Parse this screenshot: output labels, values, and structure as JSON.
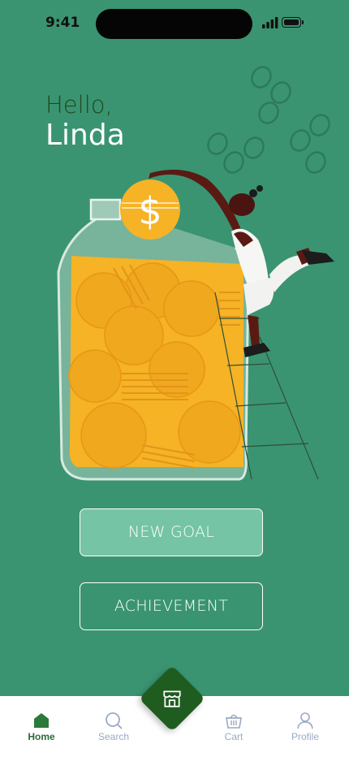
{
  "status_bar": {
    "time": "9:41"
  },
  "greeting": {
    "line1": "Hello,",
    "name": "Linda"
  },
  "actions": {
    "new_goal": "NEW GOAL",
    "achievement": "ACHIEVEMENT"
  },
  "illustration": {
    "symbol": "$"
  },
  "tabs": [
    {
      "label": "Home",
      "icon": "home-icon",
      "active": true
    },
    {
      "label": "Search",
      "icon": "search-icon",
      "active": false
    },
    {
      "label": "",
      "icon": "store-icon",
      "active": false
    },
    {
      "label": "Cart",
      "icon": "basket-icon",
      "active": false
    },
    {
      "label": "Profile",
      "icon": "person-icon",
      "active": false
    }
  ],
  "colors": {
    "background": "#3a9471",
    "accent_dark": "#1f5c1f",
    "button_fill": "#74c4a5",
    "coin": "#f5b325",
    "tab_inactive": "#9aa9c4"
  }
}
